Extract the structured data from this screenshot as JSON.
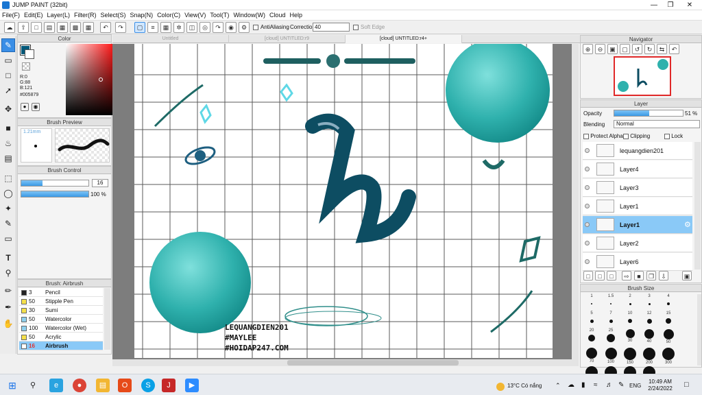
{
  "app": {
    "title": "JUMP PAINT (32bit)"
  },
  "menu": [
    "File(F)",
    "Edit(E)",
    "Layer(L)",
    "Filter(R)",
    "Select(S)",
    "Snap(N)",
    "Color(C)",
    "View(V)",
    "Tool(T)",
    "Window(W)",
    "Cloud",
    "Help"
  ],
  "toolbar": {
    "antialias_label": "AntiAliasing",
    "correction_label": "Correction",
    "correction_value": "40",
    "softedge_label": "Soft Edge"
  },
  "color_panel": {
    "title": "Color",
    "r": "R:0",
    "g": "G:88",
    "b": "B:121",
    "hex": "#005879",
    "fg_color": "#005879"
  },
  "brush_preview": {
    "title": "Brush Preview",
    "size_label": "1.21mm"
  },
  "brush_control": {
    "title": "Brush Control",
    "size_value": "16",
    "opacity_value": "100 %"
  },
  "brush_list": {
    "title": "Brush: Airbrush",
    "items": [
      {
        "size": "3",
        "name": "Pencil",
        "color": "#222222"
      },
      {
        "size": "50",
        "name": "Stipple Pen",
        "color": "#f5e04a"
      },
      {
        "size": "30",
        "name": "Sumi",
        "color": "#f5e04a"
      },
      {
        "size": "50",
        "name": "Watercolor",
        "color": "#8fd0ee"
      },
      {
        "size": "100",
        "name": "Watercolor (Wet)",
        "color": "#8fd0ee"
      },
      {
        "size": "50",
        "name": "Acrylic",
        "color": "#f5e04a"
      },
      {
        "size": "16",
        "name": "Airbrush",
        "color": "#ffffff"
      }
    ]
  },
  "tabs": [
    "Untitled",
    "[cloud] UNTITLED:r9",
    "[cloud] UNTITLED:r4+"
  ],
  "canvas": {
    "caption_line1": "LEQUANGDIEN201",
    "caption_line2": "#MAYLEE",
    "caption_line3": "#HOIDAP247.COM",
    "letter": "h"
  },
  "navigator": {
    "title": "Navigator"
  },
  "layer_panel": {
    "title": "Layer",
    "opacity_label": "Opacity",
    "opacity_value": "51 %",
    "opacity_fraction": 0.51,
    "blending_label": "Blending",
    "blending_value": "Normal",
    "protect_alpha": "Protect Alpha",
    "clipping": "Clipping",
    "lock": "Lock",
    "layers": [
      "lequangdien201",
      "Layer4",
      "Layer3",
      "Layer1",
      "Layer1",
      "Layer2",
      "Layer6"
    ]
  },
  "brush_size": {
    "title": "Brush Size",
    "sizes": [
      "1",
      "1.5",
      "2",
      "3",
      "4",
      "5",
      "7",
      "10",
      "12",
      "15",
      "20",
      "25",
      "30",
      "40",
      "50",
      "70",
      "100",
      "150",
      "200",
      "300",
      "400",
      "500",
      "700",
      "1000"
    ]
  },
  "taskbar": {
    "weather": "13°C Có nắng",
    "lang": "ENG",
    "time": "10:49 AM",
    "date": "2/24/2022"
  }
}
